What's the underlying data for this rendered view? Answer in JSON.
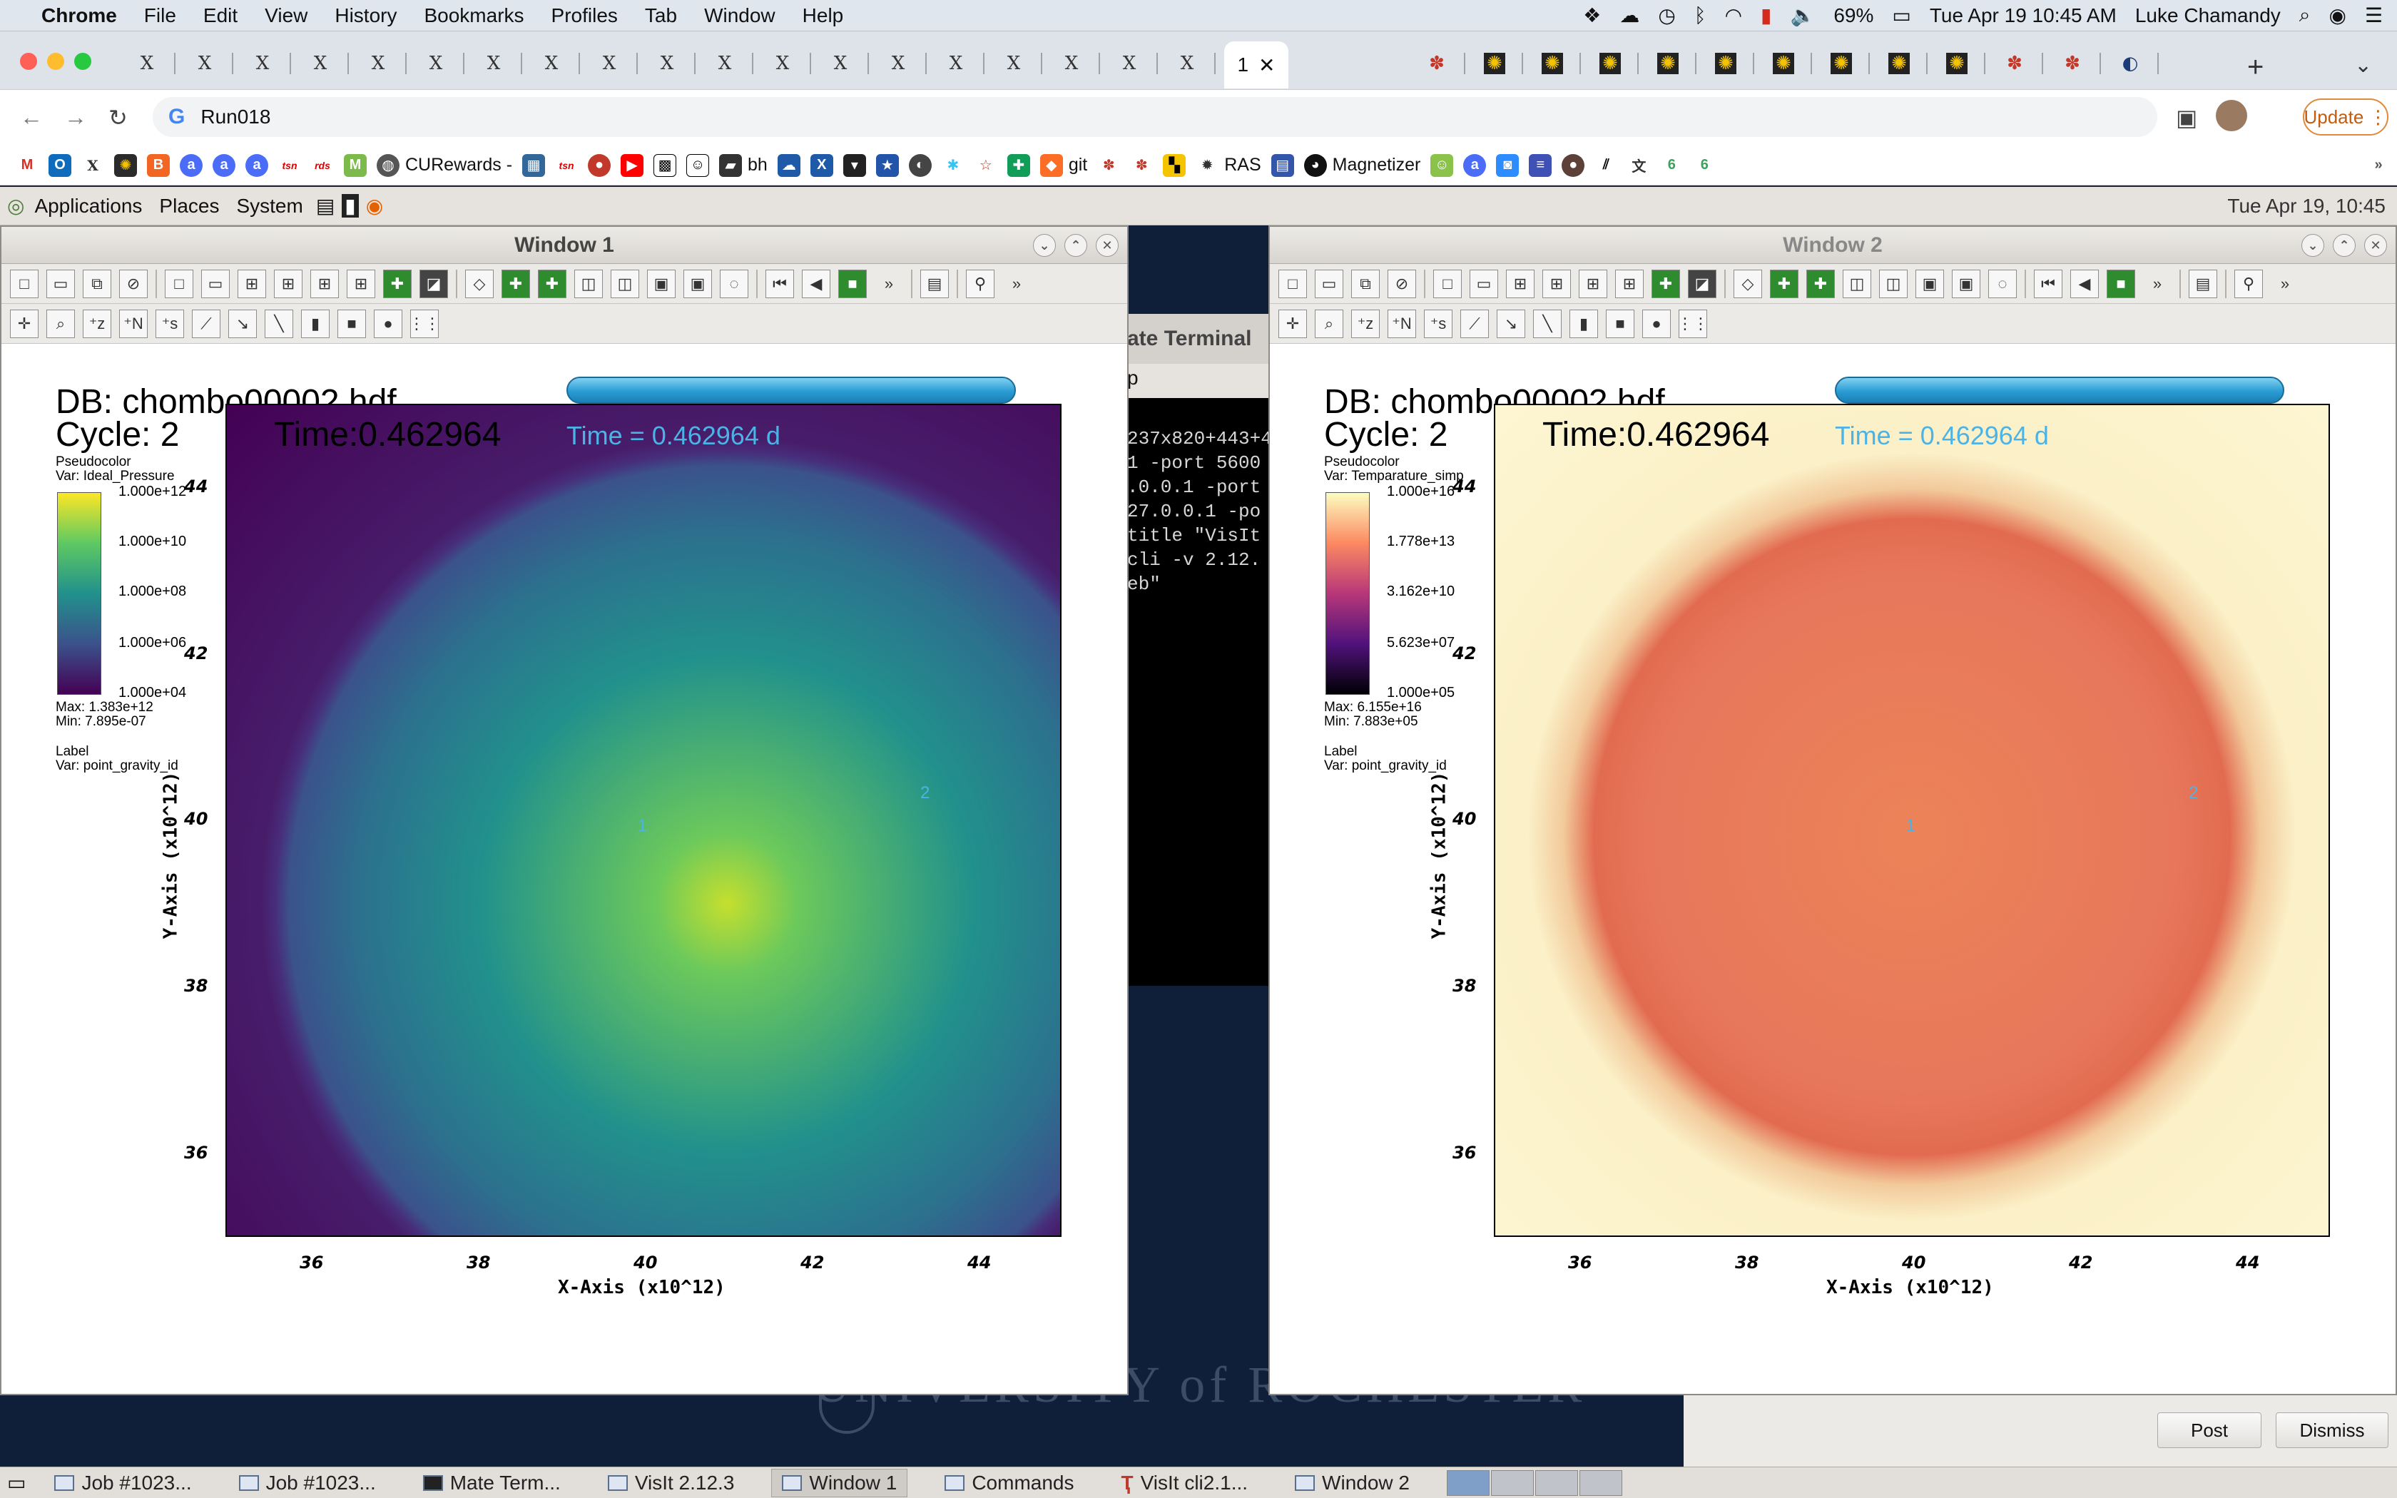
{
  "menubar": {
    "app": "Chrome",
    "items": [
      "File",
      "Edit",
      "View",
      "History",
      "Bookmarks",
      "Profiles",
      "Tab",
      "Window",
      "Help"
    ],
    "battery": "69%",
    "datetime": "Tue Apr 19  10:45 AM",
    "user": "Luke Chamandy"
  },
  "browser": {
    "active_tab_label": "1",
    "address": "Run018",
    "update_label": "Update",
    "bookmarks": [
      "CURewards -",
      "bh",
      "git",
      "RAS",
      "Magnetizer"
    ]
  },
  "gnome_panel": {
    "items": [
      "Applications",
      "Places",
      "System"
    ],
    "clock": "Tue Apr 19, 10:45"
  },
  "terminal": {
    "title": "ate Terminal",
    "menu": "p",
    "lines": [
      "237x820+443+4",
      "1 -port 5600",
      ".0.0.1 -port",
      "27.0.0.1 -po",
      "title \"VisIt",
      "cli -v 2.12.",
      "eb\""
    ]
  },
  "desktop": {
    "university": "UNIVERSITY of ROCHESTER"
  },
  "window1": {
    "title": "Window 1",
    "db": "DB: chombo00002.hdf",
    "cycle": "Cycle: 2",
    "time": "Time:0.462964",
    "time_cyan": "Time = 0.462964 d",
    "legend": {
      "type": "Pseudocolor",
      "var": "Var: Ideal_Pressure",
      "ticks": [
        "1.000e+12",
        "1.000e+10",
        "1.000e+08",
        "1.000e+06",
        "1.000e+04"
      ],
      "max": "Max:  1.383e+12",
      "min": "Min:  7.895e-07",
      "label_hdr": "Label",
      "label_var": "Var: point_gravity_id"
    },
    "colormap": [
      "#440154",
      "#3b528b",
      "#21918c",
      "#5ec962",
      "#fde725"
    ]
  },
  "window2": {
    "title": "Window 2",
    "db": "DB: chombo00002.hdf",
    "cycle": "Cycle: 2",
    "time": "Time:0.462964",
    "time_cyan": "Time = 0.462964 d",
    "legend": {
      "type": "Pseudocolor",
      "var": "Var: Temparature_simp",
      "ticks": [
        "1.000e+16",
        "1.778e+13",
        "3.162e+10",
        "5.623e+07",
        "1.000e+05"
      ],
      "max": "Max:  6.155e+16",
      "min": "Min:  7.883e+05",
      "label_hdr": "Label",
      "label_var": "Var: point_gravity_id"
    },
    "colormap": [
      "#000004",
      "#51127c",
      "#b73779",
      "#fc8961",
      "#fcfdbf"
    ]
  },
  "plot": {
    "x_ticks": [
      "36",
      "38",
      "40",
      "42",
      "44"
    ],
    "y_ticks": [
      "44",
      "42",
      "40",
      "38",
      "36"
    ],
    "xlabel": "X-Axis (x10^12)",
    "ylabel": "Y-Axis (x10^12)",
    "point_labels": [
      "1",
      "2"
    ]
  },
  "post_panel": {
    "post": "Post",
    "dismiss": "Dismiss"
  },
  "taskbar": {
    "items": [
      "Job #1023...",
      "Job #1023...",
      "Mate Term...",
      "VisIt 2.12.3",
      "Window 1",
      "Commands",
      "VisIt cli2.1...",
      "Window 2"
    ],
    "active_index": 4
  }
}
